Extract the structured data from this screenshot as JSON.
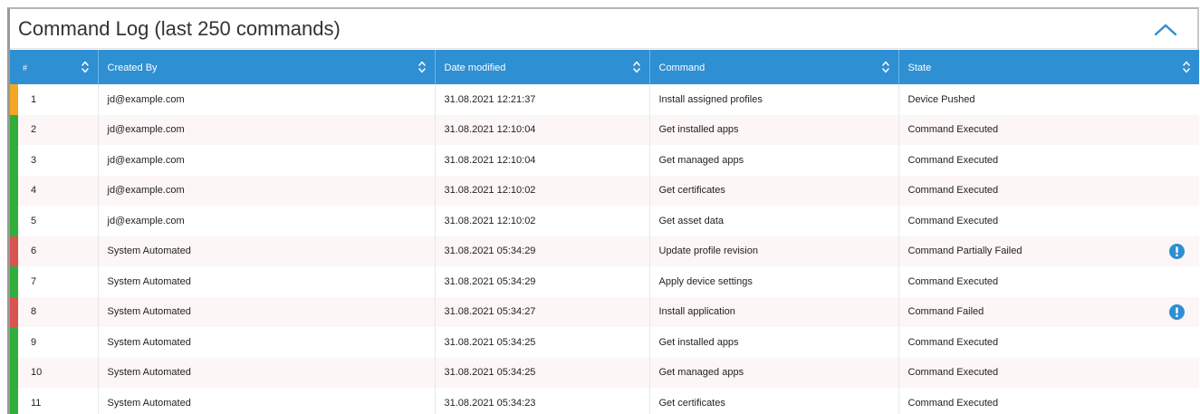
{
  "panel": {
    "title": "Command Log (last 250 commands)"
  },
  "colors": {
    "header_bg": "#2e8fd2",
    "status_pushed": "#f5a623",
    "status_executed": "#2fae3a",
    "status_failed": "#d9534f",
    "warning_icon": "#2e8fd2"
  },
  "table": {
    "columns": [
      {
        "key": "num",
        "label": "#",
        "sort_icon": "sort-updown-icon"
      },
      {
        "key": "created_by",
        "label": "Created By",
        "sort_icon": "sort-updown-icon"
      },
      {
        "key": "date_modified",
        "label": "Date modified",
        "sort_icon": "sort-updown-icon"
      },
      {
        "key": "command",
        "label": "Command",
        "sort_icon": "sort-updown-icon"
      },
      {
        "key": "state",
        "label": "State",
        "sort_icon": "sort-updown-icon"
      }
    ],
    "rows": [
      {
        "num": "1",
        "created_by": "jd@example.com",
        "date_modified": "31.08.2021 12:21:37",
        "command": "Install assigned profiles",
        "state": "Device Pushed",
        "status": "pushed",
        "warning": false
      },
      {
        "num": "2",
        "created_by": "jd@example.com",
        "date_modified": "31.08.2021 12:10:04",
        "command": "Get installed apps",
        "state": "Command Executed",
        "status": "executed",
        "warning": false
      },
      {
        "num": "3",
        "created_by": "jd@example.com",
        "date_modified": "31.08.2021 12:10:04",
        "command": "Get managed apps",
        "state": "Command Executed",
        "status": "executed",
        "warning": false
      },
      {
        "num": "4",
        "created_by": "jd@example.com",
        "date_modified": "31.08.2021 12:10:02",
        "command": "Get certificates",
        "state": "Command Executed",
        "status": "executed",
        "warning": false
      },
      {
        "num": "5",
        "created_by": "jd@example.com",
        "date_modified": "31.08.2021 12:10:02",
        "command": "Get asset data",
        "state": "Command Executed",
        "status": "executed",
        "warning": false
      },
      {
        "num": "6",
        "created_by": "System Automated",
        "date_modified": "31.08.2021 05:34:29",
        "command": "Update profile revision",
        "state": "Command Partially Failed",
        "status": "failed",
        "warning": true
      },
      {
        "num": "7",
        "created_by": "System Automated",
        "date_modified": "31.08.2021 05:34:29",
        "command": "Apply device settings",
        "state": "Command Executed",
        "status": "executed",
        "warning": false
      },
      {
        "num": "8",
        "created_by": "System Automated",
        "date_modified": "31.08.2021 05:34:27",
        "command": "Install application",
        "state": "Command Failed",
        "status": "failed",
        "warning": true
      },
      {
        "num": "9",
        "created_by": "System Automated",
        "date_modified": "31.08.2021 05:34:25",
        "command": "Get installed apps",
        "state": "Command Executed",
        "status": "executed",
        "warning": false
      },
      {
        "num": "10",
        "created_by": "System Automated",
        "date_modified": "31.08.2021 05:34:25",
        "command": "Get managed apps",
        "state": "Command Executed",
        "status": "executed",
        "warning": false
      },
      {
        "num": "11",
        "created_by": "System Automated",
        "date_modified": "31.08.2021 05:34:23",
        "command": "Get certificates",
        "state": "Command Executed",
        "status": "executed",
        "warning": false
      }
    ]
  }
}
